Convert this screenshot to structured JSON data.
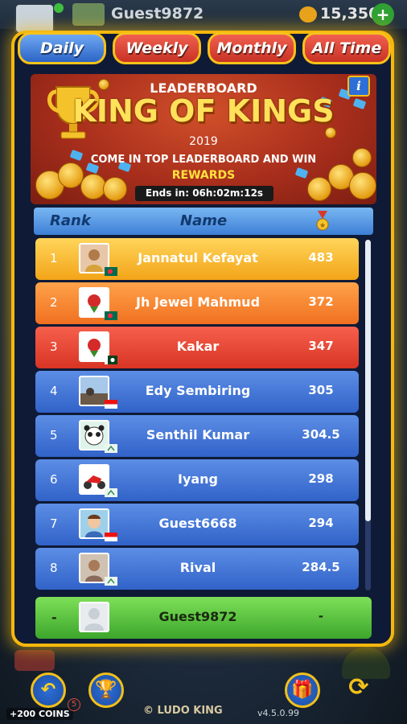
{
  "topbar": {
    "username": "Guest9872",
    "coins": "15,350",
    "plus": "+"
  },
  "tabs": [
    {
      "label": "Daily",
      "active": true
    },
    {
      "label": "Weekly",
      "active": false
    },
    {
      "label": "Monthly",
      "active": false
    },
    {
      "label": "All Time",
      "active": false
    }
  ],
  "banner": {
    "leaderboard": "LEADERBOARD",
    "title": "KING OF KINGS",
    "year": "2019",
    "subtitle": "COME IN TOP LEADERBOARD AND WIN",
    "rewards": "REWARDS",
    "ends": "Ends in: 06h:02m:12s",
    "info": "i"
  },
  "table": {
    "head_rank": "Rank",
    "head_name": "Name",
    "rows": [
      {
        "rank": "1",
        "name": "Jannatul Kefayat",
        "score": "483",
        "style": "gold",
        "avatar": "photo-woman",
        "flag": "bangladesh"
      },
      {
        "rank": "2",
        "name": "Jh Jewel Mahmud",
        "score": "372",
        "style": "orange",
        "avatar": "rose",
        "flag": "bangladesh"
      },
      {
        "rank": "3",
        "name": "Kakar",
        "score": "347",
        "style": "red",
        "avatar": "rose",
        "flag": "pakistan"
      },
      {
        "rank": "4",
        "name": "Edy Sembiring",
        "score": "305",
        "style": "blue",
        "avatar": "photo-scene",
        "flag": "indonesia"
      },
      {
        "rank": "5",
        "name": "Senthil Kumar",
        "score": "304.5",
        "style": "blue",
        "avatar": "panda",
        "flag": "india"
      },
      {
        "rank": "6",
        "name": "Iyang",
        "score": "298",
        "style": "blue",
        "avatar": "motorbike",
        "flag": "india"
      },
      {
        "rank": "7",
        "name": "Guest6668",
        "score": "294",
        "style": "blue",
        "avatar": "cartoon-man",
        "flag": "indonesia"
      },
      {
        "rank": "8",
        "name": "Rival",
        "score": "284.5",
        "style": "blue",
        "avatar": "photo-man",
        "flag": "india"
      }
    ]
  },
  "self_row": {
    "rank": "-",
    "name": "Guest9872",
    "score": "-"
  },
  "bottom": {
    "coins_label": "+200 COINS",
    "badge": "5",
    "logo": "© LUDO KING",
    "version": "v4.5.0.99"
  },
  "colors": {
    "accent_gold": "#f5b80c",
    "tab_active": "#2c64c6",
    "tab_inactive": "#c93224",
    "self_row": "#3ca62c"
  }
}
